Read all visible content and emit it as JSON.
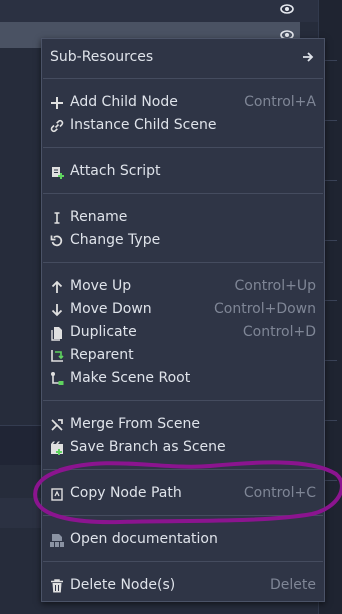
{
  "menu": {
    "sub_resources": "Sub-Resources",
    "add_child_node": {
      "label": "Add Child Node",
      "shortcut": "Control+A"
    },
    "instance_child_scene": {
      "label": "Instance Child Scene"
    },
    "attach_script": {
      "label": "Attach Script"
    },
    "rename": {
      "label": "Rename"
    },
    "change_type": {
      "label": "Change Type"
    },
    "move_up": {
      "label": "Move Up",
      "shortcut": "Control+Up"
    },
    "move_down": {
      "label": "Move Down",
      "shortcut": "Control+Down"
    },
    "duplicate": {
      "label": "Duplicate",
      "shortcut": "Control+D"
    },
    "reparent": {
      "label": "Reparent"
    },
    "make_scene_root": {
      "label": "Make Scene Root"
    },
    "merge_from_scene": {
      "label": "Merge From Scene"
    },
    "save_branch_as_scene": {
      "label": "Save Branch as Scene"
    },
    "copy_node_path": {
      "label": "Copy Node Path",
      "shortcut": "Control+C"
    },
    "open_documentation": {
      "label": "Open documentation"
    },
    "delete_nodes": {
      "label": "Delete Node(s)",
      "shortcut": "Delete"
    }
  },
  "icons": {
    "sub_resources": "arrow-right-icon",
    "add_child_node": "plus-icon",
    "instance_child_scene": "link-icon",
    "attach_script": "script-add-icon",
    "rename": "text-cursor-icon",
    "change_type": "rotate-icon",
    "move_up": "arrow-up-icon",
    "move_down": "arrow-down-icon",
    "duplicate": "duplicate-icon",
    "reparent": "reparent-icon",
    "make_scene_root": "scene-root-icon",
    "merge_from_scene": "merge-icon",
    "save_branch_as_scene": "save-scene-icon",
    "copy_node_path": "copy-path-icon",
    "open_documentation": "help-doc-icon",
    "delete_nodes": "trash-icon"
  },
  "colors": {
    "menu_bg": "#2f3546",
    "text": "#dfe3ea",
    "shortcut": "#7f8696",
    "annotation": "#8b148f"
  }
}
